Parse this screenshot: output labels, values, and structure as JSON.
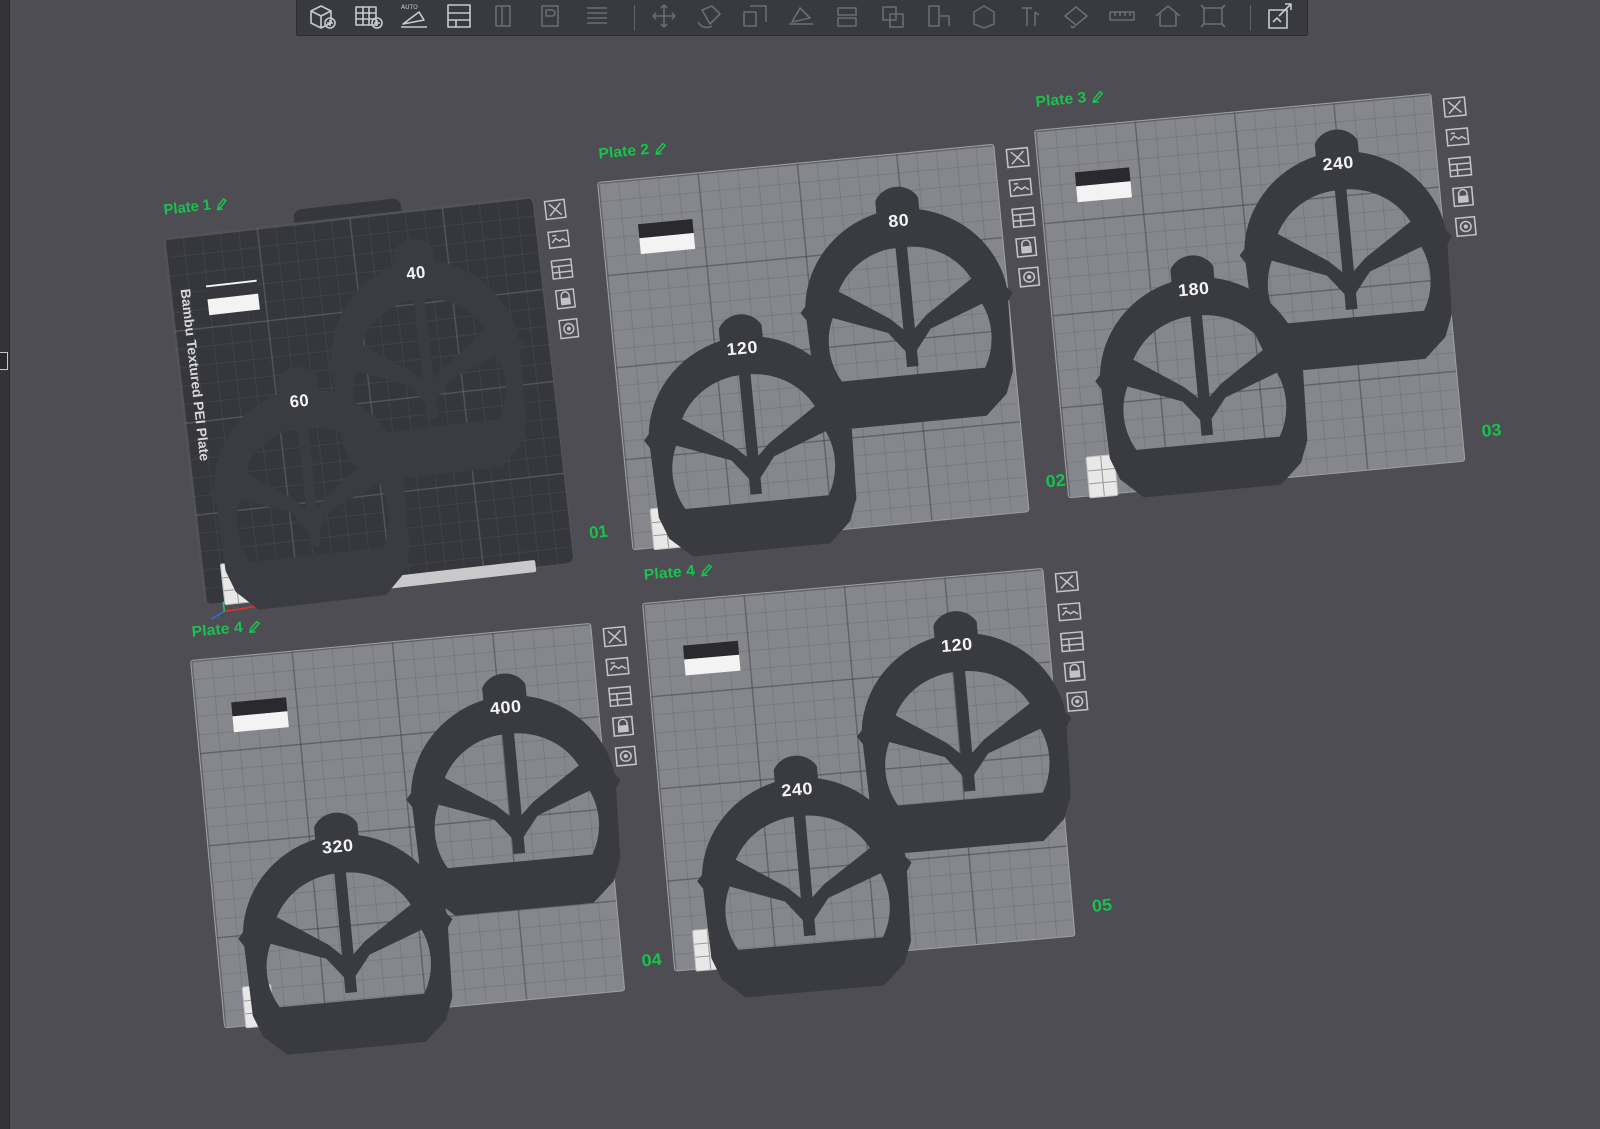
{
  "app": {
    "colors": {
      "label_green": "#19c24c",
      "part_dark": "#3a3b40",
      "bed_light": "#86878d",
      "background": "#4d4d53"
    }
  },
  "toolbar": {
    "tools": [
      {
        "name": "add-object",
        "icon": "cube-plus-icon"
      },
      {
        "name": "add-plate",
        "icon": "grid-plus-icon"
      },
      {
        "name": "auto-orient",
        "icon": "auto-orient-icon",
        "text": "AUTO"
      },
      {
        "name": "arrange",
        "icon": "arrange-icon"
      },
      {
        "name": "split-objects",
        "icon": "split-objects-icon",
        "dim": true
      },
      {
        "name": "split-parts",
        "icon": "split-parts-icon",
        "dim": true
      },
      {
        "name": "layers",
        "icon": "layers-icon",
        "dim": true
      },
      {
        "name": "move",
        "icon": "move-icon",
        "dim": true
      },
      {
        "name": "rotate",
        "icon": "rotate-icon",
        "dim": true
      },
      {
        "name": "scale",
        "icon": "scale-icon",
        "dim": true
      },
      {
        "name": "lay-on-face",
        "icon": "lay-on-face-icon",
        "dim": true
      },
      {
        "name": "cut",
        "icon": "cut-icon",
        "dim": true
      },
      {
        "name": "mesh-boolean",
        "icon": "boolean-icon",
        "dim": true
      },
      {
        "name": "support-paint",
        "icon": "support-paint-icon",
        "dim": true
      },
      {
        "name": "seam-paint",
        "icon": "seam-paint-icon",
        "dim": true
      },
      {
        "name": "text-shape",
        "icon": "text-shape-icon",
        "dim": true
      },
      {
        "name": "color-paint",
        "icon": "color-paint-icon",
        "dim": true
      },
      {
        "name": "measure",
        "icon": "measure-icon",
        "dim": true
      },
      {
        "name": "assembly",
        "icon": "assembly-icon",
        "dim": true
      },
      {
        "name": "emboss",
        "icon": "emboss-icon",
        "dim": true
      },
      {
        "name": "assemble-view",
        "icon": "assemble-view-icon"
      }
    ]
  },
  "plates": [
    {
      "id": "plate-1",
      "label": "Plate 1",
      "number": "01",
      "style": "dark",
      "bed_name": "Bambu Textured PEI Plate",
      "parts": [
        {
          "label": "40"
        },
        {
          "label": "60"
        }
      ]
    },
    {
      "id": "plate-2",
      "label": "Plate 2",
      "number": "02",
      "style": "light",
      "parts": [
        {
          "label": "80"
        },
        {
          "label": "120"
        }
      ]
    },
    {
      "id": "plate-3",
      "label": "Plate 3",
      "number": "03",
      "style": "light",
      "parts": [
        {
          "label": "240"
        },
        {
          "label": "180"
        }
      ]
    },
    {
      "id": "plate-4",
      "label": "Plate 4",
      "number": "04",
      "style": "light",
      "parts": [
        {
          "label": "400"
        },
        {
          "label": "320"
        }
      ]
    },
    {
      "id": "plate-5",
      "label": "Plate 4",
      "number": "05",
      "style": "light",
      "parts": [
        {
          "label": "120"
        },
        {
          "label": "240"
        }
      ]
    }
  ],
  "plate_tools": [
    {
      "name": "remove-plate",
      "icon": "close-icon"
    },
    {
      "name": "arrange-plate",
      "icon": "arrange-plate-icon"
    },
    {
      "name": "orient-plate",
      "icon": "orient-plate-icon"
    },
    {
      "name": "lock-plate",
      "icon": "lock-icon"
    },
    {
      "name": "plate-settings",
      "icon": "settings-icon"
    }
  ]
}
